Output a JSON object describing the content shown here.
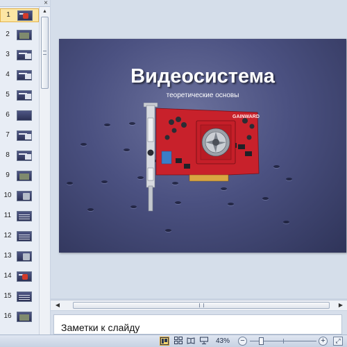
{
  "slides_pane": {
    "close_glyph": "×",
    "selected_index": 0,
    "thumbnails": [
      {
        "number": "1",
        "kind": "title-red"
      },
      {
        "number": "2",
        "kind": "picture"
      },
      {
        "number": "3",
        "kind": "block"
      },
      {
        "number": "4",
        "kind": "block"
      },
      {
        "number": "5",
        "kind": "block"
      },
      {
        "number": "6",
        "kind": "plain"
      },
      {
        "number": "7",
        "kind": "block"
      },
      {
        "number": "8",
        "kind": "block"
      },
      {
        "number": "9",
        "kind": "picture"
      },
      {
        "number": "10",
        "kind": "figure"
      },
      {
        "number": "11",
        "kind": "lines"
      },
      {
        "number": "12",
        "kind": "lines"
      },
      {
        "number": "13",
        "kind": "figure"
      },
      {
        "number": "14",
        "kind": "title-red"
      },
      {
        "number": "15",
        "kind": "lines"
      },
      {
        "number": "16",
        "kind": "picture"
      }
    ]
  },
  "slide": {
    "title": "Видеосистема",
    "subtitle": "теоретические основы",
    "background_color": "#4b5181",
    "card_brand": "GAINWARD",
    "card_color": "#d2202a"
  },
  "notes": {
    "placeholder": "Заметки к слайду"
  },
  "status_bar": {
    "view_normal_icon": "normal-view-icon",
    "view_sorter_icon": "slide-sorter-icon",
    "view_reading_icon": "reading-view-icon",
    "view_slideshow_icon": "slideshow-icon",
    "zoom": "43%",
    "zoom_fraction": 0.43,
    "zoom_out_glyph": "−",
    "zoom_in_glyph": "+",
    "fit_glyph": "⤢"
  },
  "scroll": {
    "up_glyph": "▲",
    "left_glyph": "◀",
    "right_glyph": "▶"
  }
}
